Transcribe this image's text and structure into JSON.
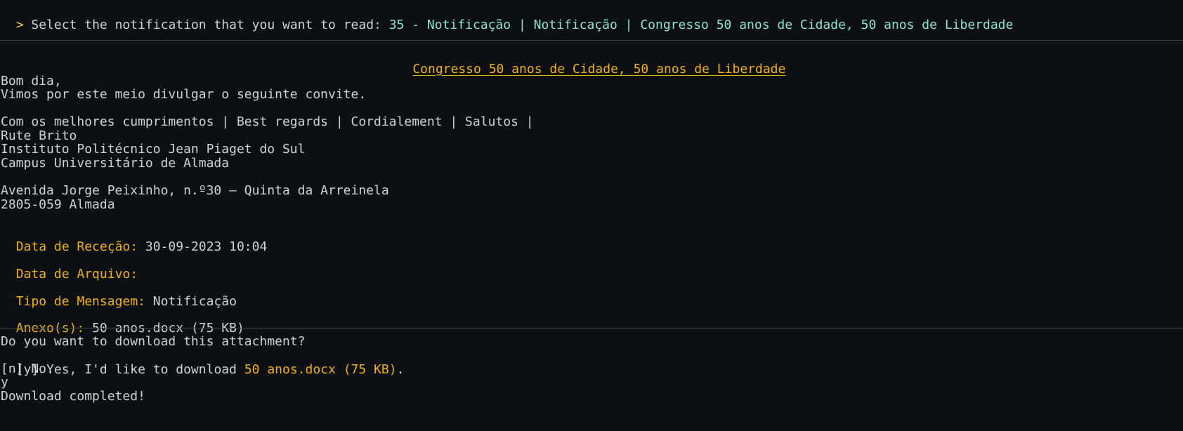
{
  "prompt": {
    "symbol": ">",
    "question": "Select the notification that you want to read:",
    "answer": "35 - Notificação | Notificação | Congresso 50 anos de Cidade, 50 anos de Liberdade"
  },
  "message": {
    "title": "Congresso 50 anos de Cidade, 50 anos de Liberdade",
    "body": [
      "Bom dia,",
      "Vimos por este meio divulgar o seguinte convite.",
      "",
      "Com os melhores cumprimentos | Best regards | Cordialement | Salutos |",
      "Rute Brito",
      "Instituto Politécnico Jean Piaget do Sul",
      "Campus Universitário de Almada",
      "",
      "Avenida Jorge Peixinho, n.º30 – Quinta da Arreinela",
      "2805-059 Almada"
    ],
    "fields": {
      "received_label": "Data de Receção:",
      "received_value": "30-09-2023 10:04",
      "archive_label": "Data de Arquivo:",
      "archive_value": "",
      "type_label": "Tipo de Mensagem:",
      "type_value": "Notificação",
      "attachment_label": "Anexo(s):",
      "attachment_value": "50 anos.docx (75 KB)"
    }
  },
  "download": {
    "question": "Do you want to download this attachment?",
    "yes_prefix": "[y] Yes, I'd like to download",
    "yes_file": "50 anos.docx (75 KB)",
    "yes_suffix": ".",
    "no_option": "[n] No.",
    "user_input": "y",
    "status": "Download completed!"
  },
  "colors": {
    "background": "#0c0f14",
    "text": "#cfd3d6",
    "accent": "#8fe3cf",
    "label": "#f2b300",
    "prompt": "#f2c744"
  }
}
